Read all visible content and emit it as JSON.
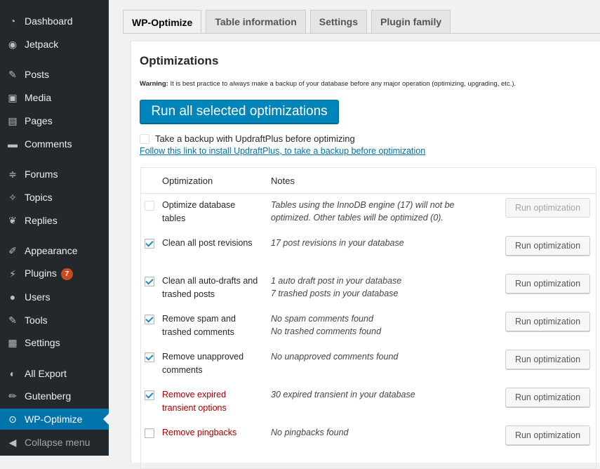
{
  "sidebar": {
    "items": [
      {
        "label": "Dashboard",
        "icon": "dashboard-icon"
      },
      {
        "label": "Jetpack",
        "icon": "jetpack-icon"
      },
      {
        "label": "Posts",
        "icon": "pin-icon"
      },
      {
        "label": "Media",
        "icon": "media-icon"
      },
      {
        "label": "Pages",
        "icon": "pages-icon"
      },
      {
        "label": "Comments",
        "icon": "comments-icon"
      },
      {
        "label": "Forums",
        "icon": "forums-icon"
      },
      {
        "label": "Topics",
        "icon": "topics-icon"
      },
      {
        "label": "Replies",
        "icon": "replies-icon"
      },
      {
        "label": "Appearance",
        "icon": "appearance-icon"
      },
      {
        "label": "Plugins",
        "icon": "plugins-icon",
        "badge": "7"
      },
      {
        "label": "Users",
        "icon": "users-icon"
      },
      {
        "label": "Tools",
        "icon": "tools-icon"
      },
      {
        "label": "Settings",
        "icon": "settings-icon"
      },
      {
        "label": "All Export",
        "icon": "export-icon"
      },
      {
        "label": "Gutenberg",
        "icon": "gutenberg-icon"
      },
      {
        "label": "WP-Optimize",
        "icon": "wp-optimize-icon",
        "current": true
      },
      {
        "label": "Collapse menu",
        "icon": "collapse-icon"
      }
    ]
  },
  "tabs": [
    "WP-Optimize",
    "Table information",
    "Settings",
    "Plugin family"
  ],
  "main": {
    "title": "Optimizations",
    "warning_label": "Warning:",
    "warning_text": " It is best practice to always make a backup of your database before any major operation (optimizing, upgrading, etc.).",
    "run_all_label": "Run all selected optimizations",
    "backup_label": "Take a backup with UpdraftPlus before optimizing",
    "install_link": "Follow this link to install UpdraftPlus, to take a backup before optimization"
  },
  "table": {
    "col_optimization": "Optimization",
    "col_notes": "Notes",
    "rows": [
      {
        "name": "Optimize database tables",
        "notes": [
          "Tables using the InnoDB engine (17) will not be optimized. Other tables will be optimized (0)."
        ],
        "checked": false,
        "disabled": true,
        "red": false,
        "button": "Run optimization"
      },
      {
        "name": "Clean all post revisions",
        "notes": [
          "17 post revisions in your database"
        ],
        "checked": true,
        "disabled": false,
        "red": false,
        "button": "Run optimization"
      },
      {
        "name": "Clean all auto-drafts and trashed posts",
        "notes": [
          "1 auto draft post in your database",
          "7 trashed posts in your database"
        ],
        "checked": true,
        "disabled": false,
        "red": false,
        "button": "Run optimization"
      },
      {
        "name": "Remove spam and trashed comments",
        "notes": [
          "No spam comments found",
          "No trashed comments found"
        ],
        "checked": true,
        "disabled": false,
        "red": false,
        "button": "Run optimization"
      },
      {
        "name": "Remove unapproved comments",
        "notes": [
          "No unapproved comments found"
        ],
        "checked": true,
        "disabled": false,
        "red": false,
        "button": "Run optimization"
      },
      {
        "name": "Remove expired transient options",
        "notes": [
          "30 expired transient in your database"
        ],
        "checked": true,
        "disabled": false,
        "red": true,
        "button": "Run optimization"
      },
      {
        "name": "Remove pingbacks",
        "notes": [
          "No pingbacks found"
        ],
        "checked": false,
        "disabled": false,
        "red": true,
        "button": "Run optimization"
      }
    ]
  },
  "colors": {
    "sidebar_bg": "#23282d",
    "accent": "#0073aa",
    "primary_button": "#0085ba",
    "warning_red": "#aa0000",
    "badge": "#ca4a1f"
  }
}
